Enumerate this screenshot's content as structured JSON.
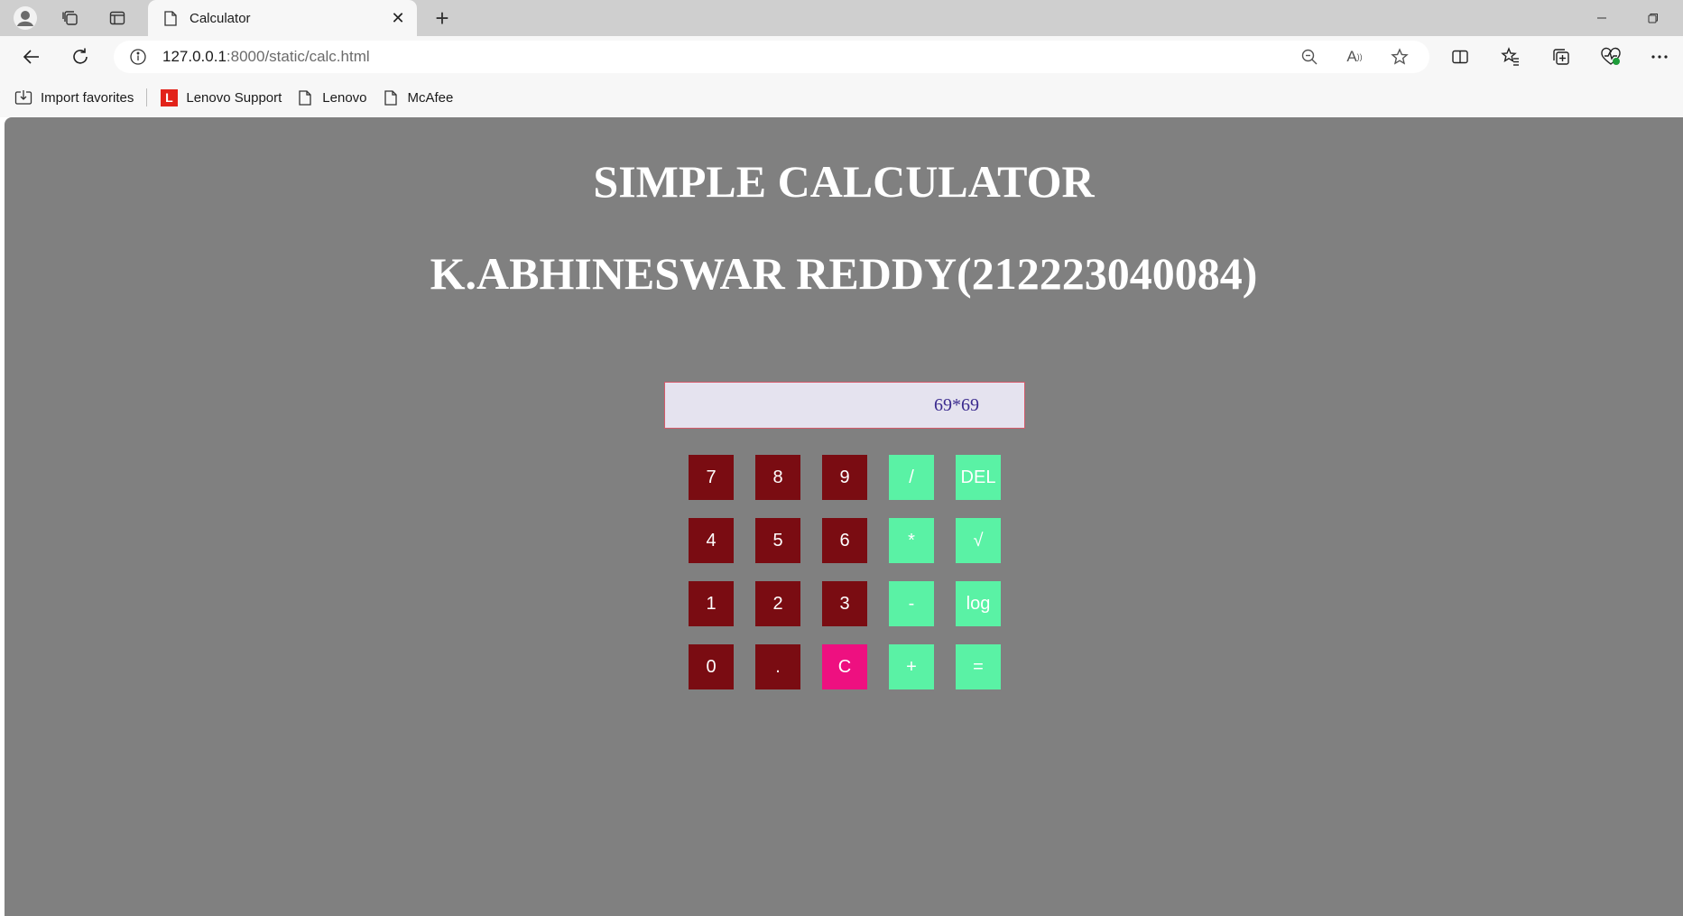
{
  "browser": {
    "tab_title": "Calculator",
    "url_host": "127.0.0.1",
    "url_rest": ":8000/static/calc.html",
    "bookmarks": [
      {
        "label": "Import favorites"
      },
      {
        "label": "Lenovo Support",
        "logo_letter": "L"
      },
      {
        "label": "Lenovo"
      },
      {
        "label": "McAfee"
      }
    ]
  },
  "page": {
    "title": "SIMPLE CALCULATOR",
    "author": "K.ABHINESWAR REDDY(212223040084)",
    "display_value": "69*69",
    "keys": [
      [
        "7",
        "8",
        "9",
        "/",
        "DEL"
      ],
      [
        "4",
        "5",
        "6",
        "*",
        "√"
      ],
      [
        "1",
        "2",
        "3",
        "-",
        "log"
      ],
      [
        "0",
        ".",
        "C",
        "+",
        "="
      ]
    ]
  },
  "colors": {
    "page_background": "#808080",
    "digit_key": "#7a0c12",
    "operator_key": "#5af2a5",
    "clear_key": "#ee1080",
    "display_background": "#e5e3ef",
    "display_text": "#3a2a8e"
  }
}
